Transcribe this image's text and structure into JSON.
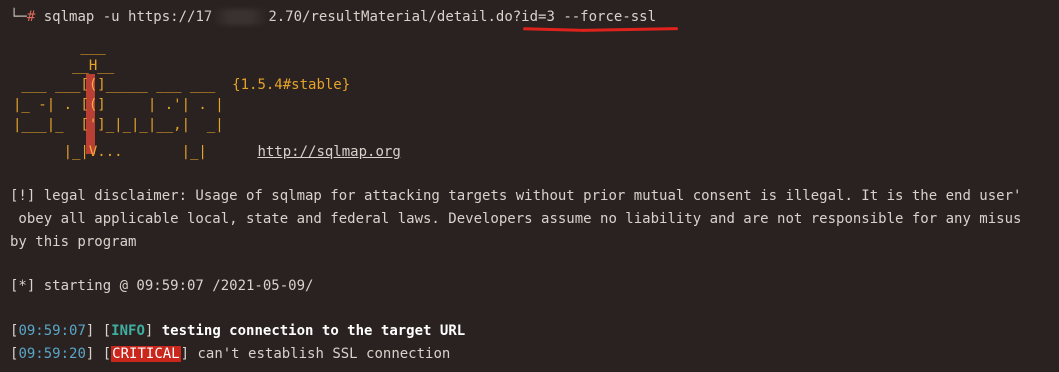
{
  "prompt": {
    "glyph": "└─",
    "hash": "#",
    "cmd_prefix": "sqlmap -u https://17",
    "cmd_suffix": "2.70/resultMaterial/detail.do",
    "cmd_highlight": "?id=3 --force-ssl"
  },
  "banner": {
    "lines": [
      "        ___",
      "       __H__",
      " ___ ___[(]_____ ___ ___  ",
      "|_ -| . [(]     | .'| . | ",
      "|___|_  [']_|_|_|__,|  _| ",
      "      |_|V...       |_|   "
    ],
    "version": "{1.5.4#stable}",
    "site": "http://sqlmap.org"
  },
  "disclaimer": {
    "line1": "[!] legal disclaimer: Usage of sqlmap for attacking targets without prior mutual consent is illegal. It is the end user'",
    "line2": " obey all applicable local, state and federal laws. Developers assume no liability and are not responsible for any misus",
    "line3": "by this program"
  },
  "starting": "[*] starting @ 09:59:07 /2021-05-09/",
  "log": [
    {
      "time": "09:59:07",
      "level": "INFO",
      "message": "testing connection to the target URL"
    },
    {
      "time": "09:59:20",
      "level": "CRITICAL",
      "message": "can't establish SSL connection"
    }
  ],
  "colors": {
    "background": "#2a2220",
    "accent_orange": "#e6a32a",
    "critical_red": "#c9271c",
    "info_teal": "#3fb0a0",
    "timestamp_blue": "#58a6c8"
  }
}
